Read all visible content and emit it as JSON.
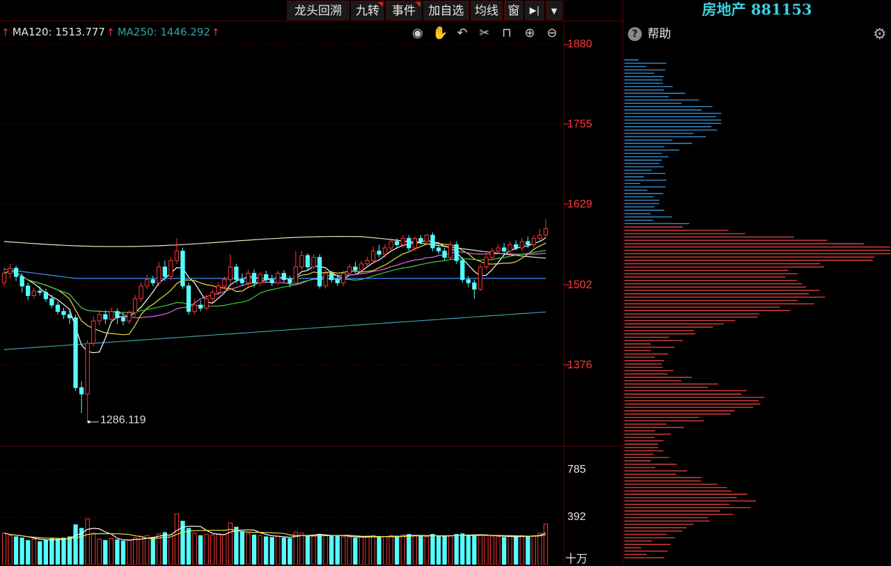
{
  "toolbar": {
    "buttons": [
      {
        "label": "龙头回溯",
        "flag": false
      },
      {
        "label": "九转",
        "flag": true
      },
      {
        "label": "事件",
        "flag": true
      },
      {
        "label": "加自选",
        "flag": false
      },
      {
        "label": "均线",
        "flag": false
      },
      {
        "label": "窗",
        "flag": false
      }
    ],
    "more_icon": "step-forward-icon",
    "dropdown_icon": "caret-down-icon"
  },
  "ma": {
    "ma120_label": "MA120: 1513.777",
    "ma250_label": "MA250: 1446.292"
  },
  "chart_tools": [
    "eye-icon",
    "hand-icon",
    "undo-icon",
    "cut-icon",
    "lock-icon",
    "zoom-in-icon",
    "zoom-out-icon"
  ],
  "price_axis": [
    "1880",
    "1755",
    "1629",
    "1502",
    "1376"
  ],
  "volume_axis": [
    "785",
    "392",
    "十万"
  ],
  "low_marker": "1286.119",
  "panel": {
    "title": "房地产 881153",
    "help_label": "帮助",
    "help_icon": "question-icon",
    "settings_icon": "gear-icon"
  },
  "colors": {
    "up": "#ff3a3a",
    "down": "#54ffff",
    "grid": "#5a0000",
    "profile_upper": "#3a8fd0",
    "profile_lower": "#e04040"
  },
  "chart_data": {
    "type": "candlestick",
    "ylim": [
      1270,
      1900
    ],
    "volume_ylim": [
      0,
      900
    ],
    "candles": [
      [
        1505,
        1520,
        1530,
        1500,
        260
      ],
      [
        1520,
        1528,
        1535,
        1512,
        240
      ],
      [
        1528,
        1515,
        1532,
        1508,
        230
      ],
      [
        1515,
        1500,
        1520,
        1490,
        220
      ],
      [
        1500,
        1485,
        1505,
        1478,
        200
      ],
      [
        1485,
        1492,
        1498,
        1480,
        210
      ],
      [
        1492,
        1490,
        1500,
        1485,
        190
      ],
      [
        1490,
        1480,
        1496,
        1475,
        205
      ],
      [
        1480,
        1470,
        1486,
        1465,
        215
      ],
      [
        1470,
        1460,
        1476,
        1455,
        210
      ],
      [
        1460,
        1455,
        1466,
        1448,
        220
      ],
      [
        1455,
        1450,
        1462,
        1440,
        230
      ],
      [
        1450,
        1340,
        1455,
        1335,
        330
      ],
      [
        1340,
        1330,
        1350,
        1300,
        300
      ],
      [
        1330,
        1410,
        1415,
        1286,
        380
      ],
      [
        1410,
        1445,
        1452,
        1405,
        260
      ],
      [
        1445,
        1455,
        1460,
        1438,
        210
      ],
      [
        1455,
        1448,
        1462,
        1440,
        200
      ],
      [
        1448,
        1460,
        1466,
        1444,
        215
      ],
      [
        1460,
        1450,
        1465,
        1440,
        205
      ],
      [
        1450,
        1445,
        1458,
        1438,
        195
      ],
      [
        1445,
        1458,
        1462,
        1440,
        200
      ],
      [
        1458,
        1480,
        1486,
        1452,
        220
      ],
      [
        1480,
        1500,
        1506,
        1475,
        235
      ],
      [
        1500,
        1510,
        1518,
        1495,
        240
      ],
      [
        1510,
        1505,
        1516,
        1500,
        225
      ],
      [
        1505,
        1530,
        1538,
        1500,
        255
      ],
      [
        1530,
        1515,
        1540,
        1508,
        265
      ],
      [
        1515,
        1540,
        1545,
        1510,
        245
      ],
      [
        1540,
        1555,
        1575,
        1535,
        420
      ],
      [
        1555,
        1500,
        1560,
        1495,
        360
      ],
      [
        1500,
        1460,
        1505,
        1455,
        300
      ],
      [
        1460,
        1470,
        1480,
        1455,
        260
      ],
      [
        1470,
        1465,
        1478,
        1460,
        240
      ],
      [
        1465,
        1480,
        1486,
        1462,
        250
      ],
      [
        1480,
        1490,
        1494,
        1475,
        245
      ],
      [
        1490,
        1500,
        1506,
        1486,
        255
      ],
      [
        1500,
        1510,
        1515,
        1494,
        250
      ],
      [
        1510,
        1530,
        1550,
        1505,
        345
      ],
      [
        1530,
        1510,
        1535,
        1505,
        310
      ],
      [
        1510,
        1505,
        1520,
        1500,
        275
      ],
      [
        1505,
        1520,
        1525,
        1500,
        255
      ],
      [
        1520,
        1505,
        1526,
        1498,
        245
      ],
      [
        1505,
        1518,
        1522,
        1500,
        240
      ],
      [
        1518,
        1510,
        1524,
        1505,
        230
      ],
      [
        1510,
        1505,
        1518,
        1500,
        225
      ],
      [
        1505,
        1520,
        1524,
        1502,
        235
      ],
      [
        1520,
        1510,
        1525,
        1506,
        220
      ],
      [
        1510,
        1505,
        1516,
        1498,
        215
      ],
      [
        1505,
        1530,
        1555,
        1500,
        270
      ],
      [
        1530,
        1548,
        1555,
        1525,
        260
      ],
      [
        1548,
        1530,
        1552,
        1525,
        240
      ],
      [
        1530,
        1545,
        1550,
        1526,
        235
      ],
      [
        1545,
        1500,
        1550,
        1496,
        250
      ],
      [
        1500,
        1520,
        1525,
        1496,
        245
      ],
      [
        1520,
        1510,
        1524,
        1505,
        240
      ],
      [
        1510,
        1505,
        1518,
        1500,
        235
      ],
      [
        1505,
        1520,
        1524,
        1500,
        230
      ],
      [
        1520,
        1530,
        1535,
        1515,
        225
      ],
      [
        1530,
        1525,
        1538,
        1520,
        220
      ],
      [
        1525,
        1535,
        1540,
        1520,
        230
      ],
      [
        1535,
        1540,
        1546,
        1530,
        235
      ],
      [
        1540,
        1555,
        1562,
        1535,
        240
      ],
      [
        1555,
        1550,
        1565,
        1545,
        225
      ],
      [
        1550,
        1560,
        1566,
        1545,
        230
      ],
      [
        1560,
        1570,
        1575,
        1555,
        240
      ],
      [
        1570,
        1565,
        1575,
        1560,
        235
      ],
      [
        1565,
        1575,
        1580,
        1560,
        245
      ],
      [
        1575,
        1560,
        1580,
        1555,
        250
      ],
      [
        1560,
        1575,
        1578,
        1555,
        240
      ],
      [
        1575,
        1570,
        1580,
        1565,
        235
      ],
      [
        1570,
        1580,
        1582,
        1565,
        230
      ],
      [
        1580,
        1560,
        1584,
        1555,
        250
      ],
      [
        1560,
        1555,
        1566,
        1550,
        235
      ],
      [
        1555,
        1545,
        1560,
        1540,
        230
      ],
      [
        1545,
        1565,
        1570,
        1540,
        240
      ],
      [
        1565,
        1540,
        1570,
        1535,
        250
      ],
      [
        1540,
        1510,
        1545,
        1505,
        255
      ],
      [
        1510,
        1505,
        1516,
        1498,
        245
      ],
      [
        1505,
        1495,
        1510,
        1480,
        240
      ],
      [
        1495,
        1530,
        1534,
        1492,
        245
      ],
      [
        1530,
        1545,
        1550,
        1525,
        240
      ],
      [
        1545,
        1555,
        1560,
        1540,
        235
      ],
      [
        1555,
        1560,
        1566,
        1550,
        230
      ],
      [
        1560,
        1555,
        1568,
        1550,
        225
      ],
      [
        1555,
        1565,
        1570,
        1550,
        235
      ],
      [
        1565,
        1560,
        1572,
        1556,
        230
      ],
      [
        1560,
        1570,
        1576,
        1555,
        240
      ],
      [
        1570,
        1565,
        1578,
        1560,
        235
      ],
      [
        1565,
        1575,
        1580,
        1560,
        240
      ],
      [
        1575,
        1580,
        1590,
        1570,
        260
      ],
      [
        1580,
        1590,
        1605,
        1575,
        335
      ]
    ]
  }
}
